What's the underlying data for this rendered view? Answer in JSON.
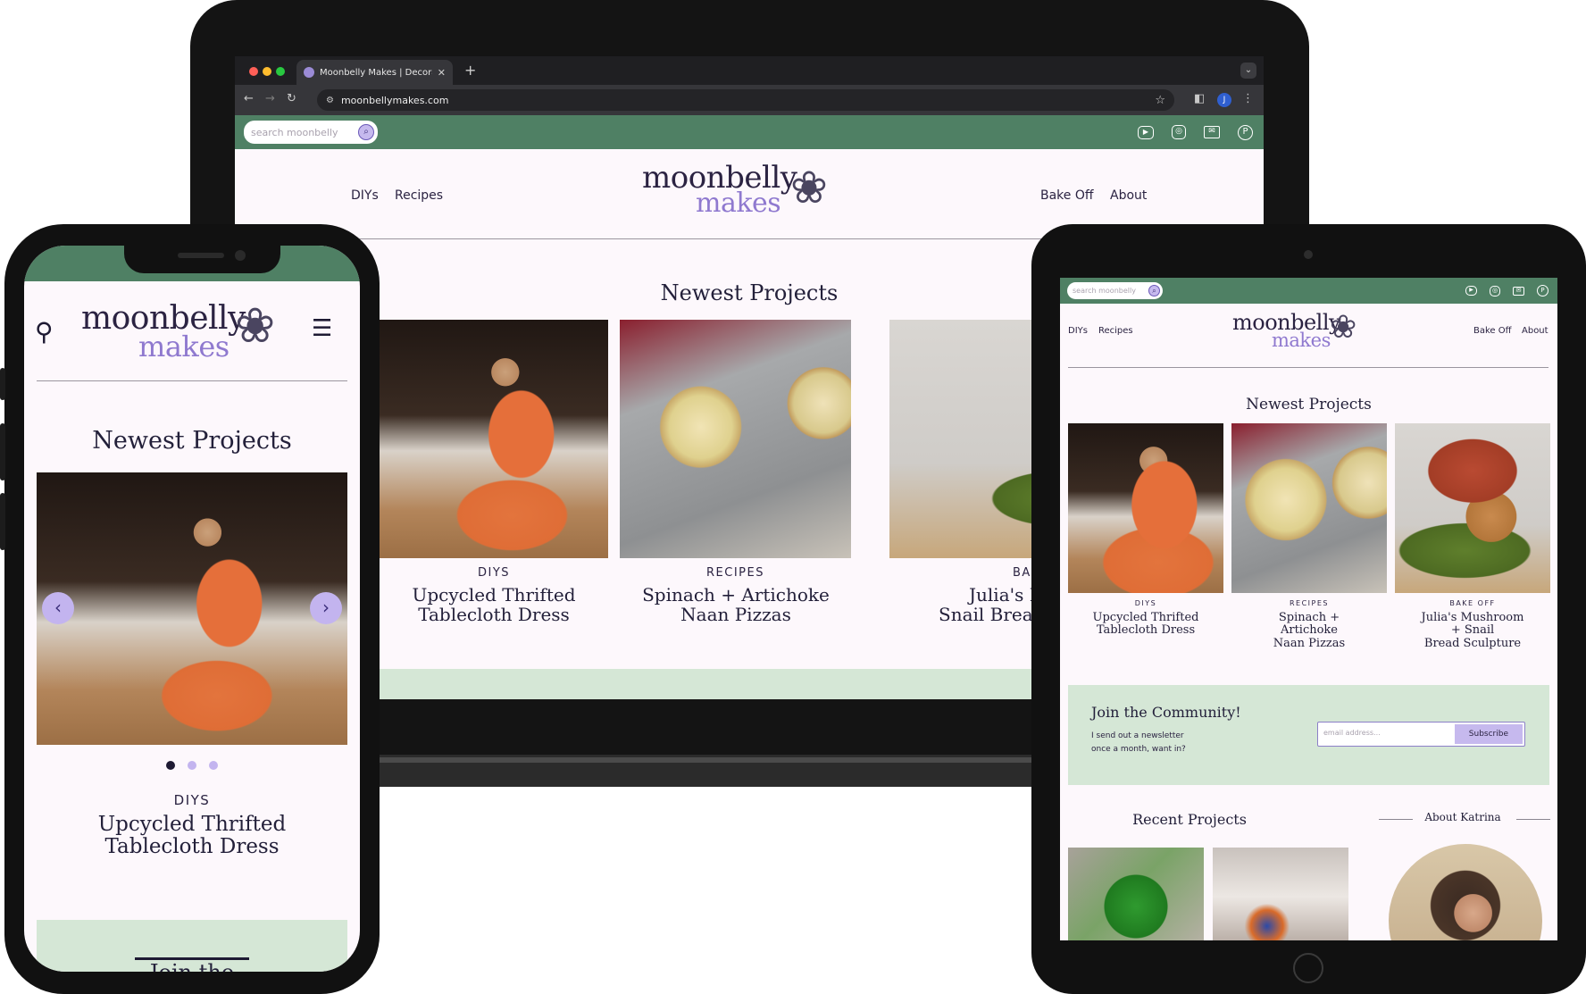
{
  "browser": {
    "tab_title": "Moonbelly Makes | Decorate",
    "url": "moonbellymakes.com",
    "account_initial": "J"
  },
  "site": {
    "search_placeholder": "search moonbelly",
    "logo_top": "moonbelly",
    "logo_bottom": "makes",
    "nav_left": [
      "DIYs",
      "Recipes"
    ],
    "nav_right": [
      "Bake Off",
      "About"
    ],
    "social_icons": [
      "youtube-icon",
      "instagram-icon",
      "mail-icon",
      "pinterest-icon"
    ],
    "newest_title": "Newest Projects",
    "projects": [
      {
        "category": "DIYS",
        "title": "Upcycled Thrifted Tablecloth Dress"
      },
      {
        "category": "RECIPES",
        "title": "Spinach + Artichoke Naan Pizzas"
      },
      {
        "category": "BAKE OFF",
        "title": "Julia's Mushroom + Snail Bread Sculpture"
      }
    ],
    "laptop_titles": [
      [
        "Upcycled Thrifted",
        "Tablecloth Dress"
      ],
      [
        "Spinach + Artichoke",
        "Naan Pizzas"
      ],
      [
        "Julia's Mush",
        "Snail Bread S"
      ]
    ],
    "laptop_cat3": "BAKE O",
    "tablet_titles": [
      [
        "Upcycled Thrifted",
        "Tablecloth Dress"
      ],
      [
        "Spinach +",
        "Artichoke",
        "Naan Pizzas"
      ],
      [
        "Julia's Mushroom",
        "+ Snail",
        "Bread Sculpture"
      ]
    ],
    "phone_title": [
      "Upcycled Thrifted",
      "Tablecloth Dress"
    ],
    "phone_join_fragment": "Join the",
    "join": {
      "title": "Join the Community!",
      "text_line1": "I send out a newsletter",
      "text_line2": "once a month, want in?",
      "email_placeholder": "email address...",
      "button": "Subscribe"
    },
    "recent_title": "Recent Projects",
    "about_heading": "About Katrina"
  },
  "colors": {
    "brand_green": "#4f8064",
    "accent_purple": "#8f79cf",
    "light_purple": "#c6b9ee",
    "mint": "#d5e7d6",
    "page_bg": "#fdf8fc"
  }
}
